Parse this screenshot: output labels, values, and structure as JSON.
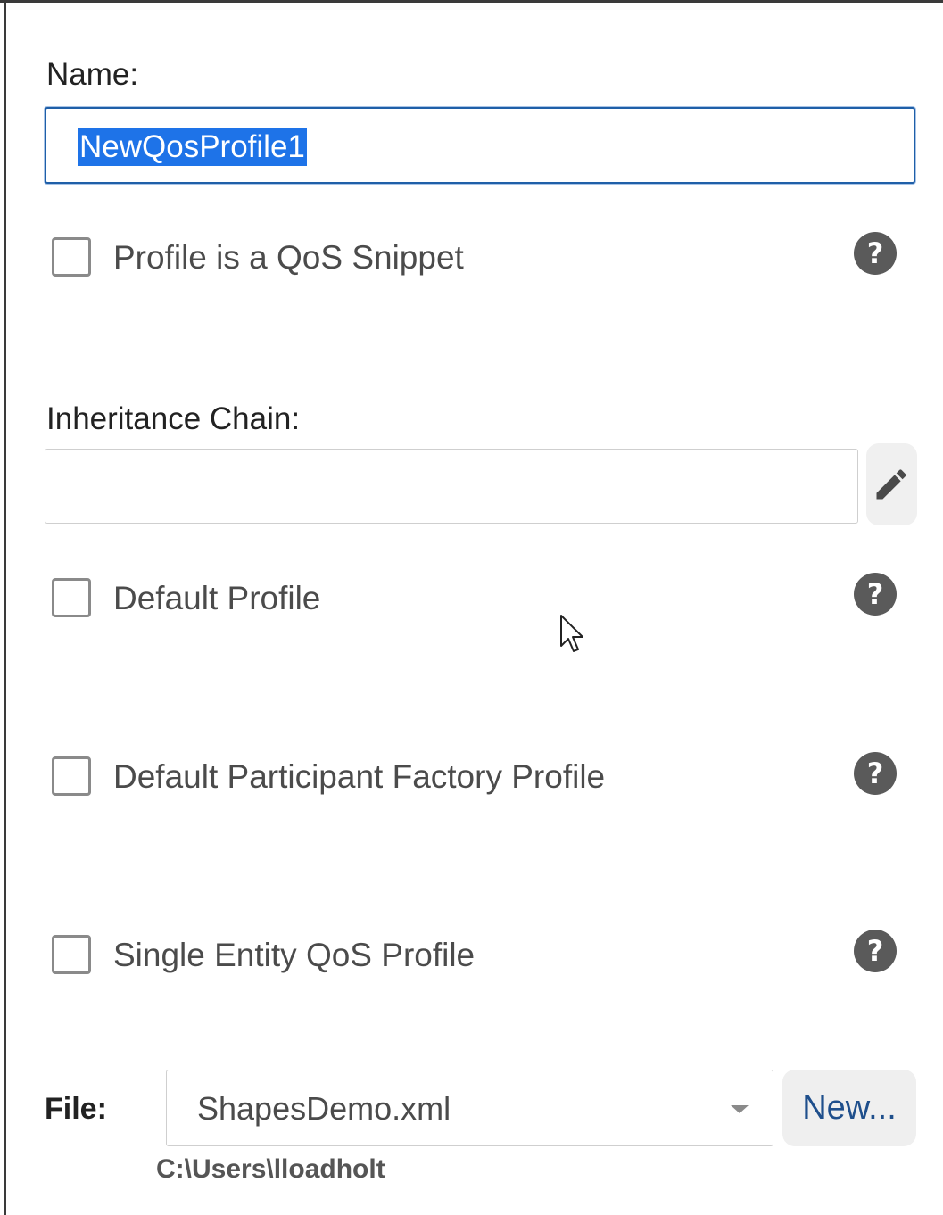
{
  "name": {
    "label": "Name:",
    "value": "NewQosProfile1"
  },
  "checkboxes": [
    {
      "label": "Profile is a QoS Snippet",
      "checked": false,
      "help_icon": "question-circle-icon"
    },
    {
      "label": "Default Profile",
      "checked": false,
      "help_icon": "question-circle-icon"
    },
    {
      "label": "Default Participant Factory Profile",
      "checked": false,
      "help_icon": "question-circle-icon"
    },
    {
      "label": "Single Entity QoS Profile",
      "checked": false,
      "help_icon": "question-circle-icon"
    }
  ],
  "inheritance": {
    "label": "Inheritance Chain:",
    "value": "",
    "edit_icon": "pencil-icon"
  },
  "file": {
    "label": "File:",
    "selected": "ShapesDemo.xml",
    "new_button": "New...",
    "path": "C:\\Users\\lloadholt"
  },
  "colors": {
    "selection": "#1e73e8",
    "focus_border": "#1f5fa8",
    "help_icon": "#5a5a5a",
    "new_button_text": "#1f4f8c"
  }
}
